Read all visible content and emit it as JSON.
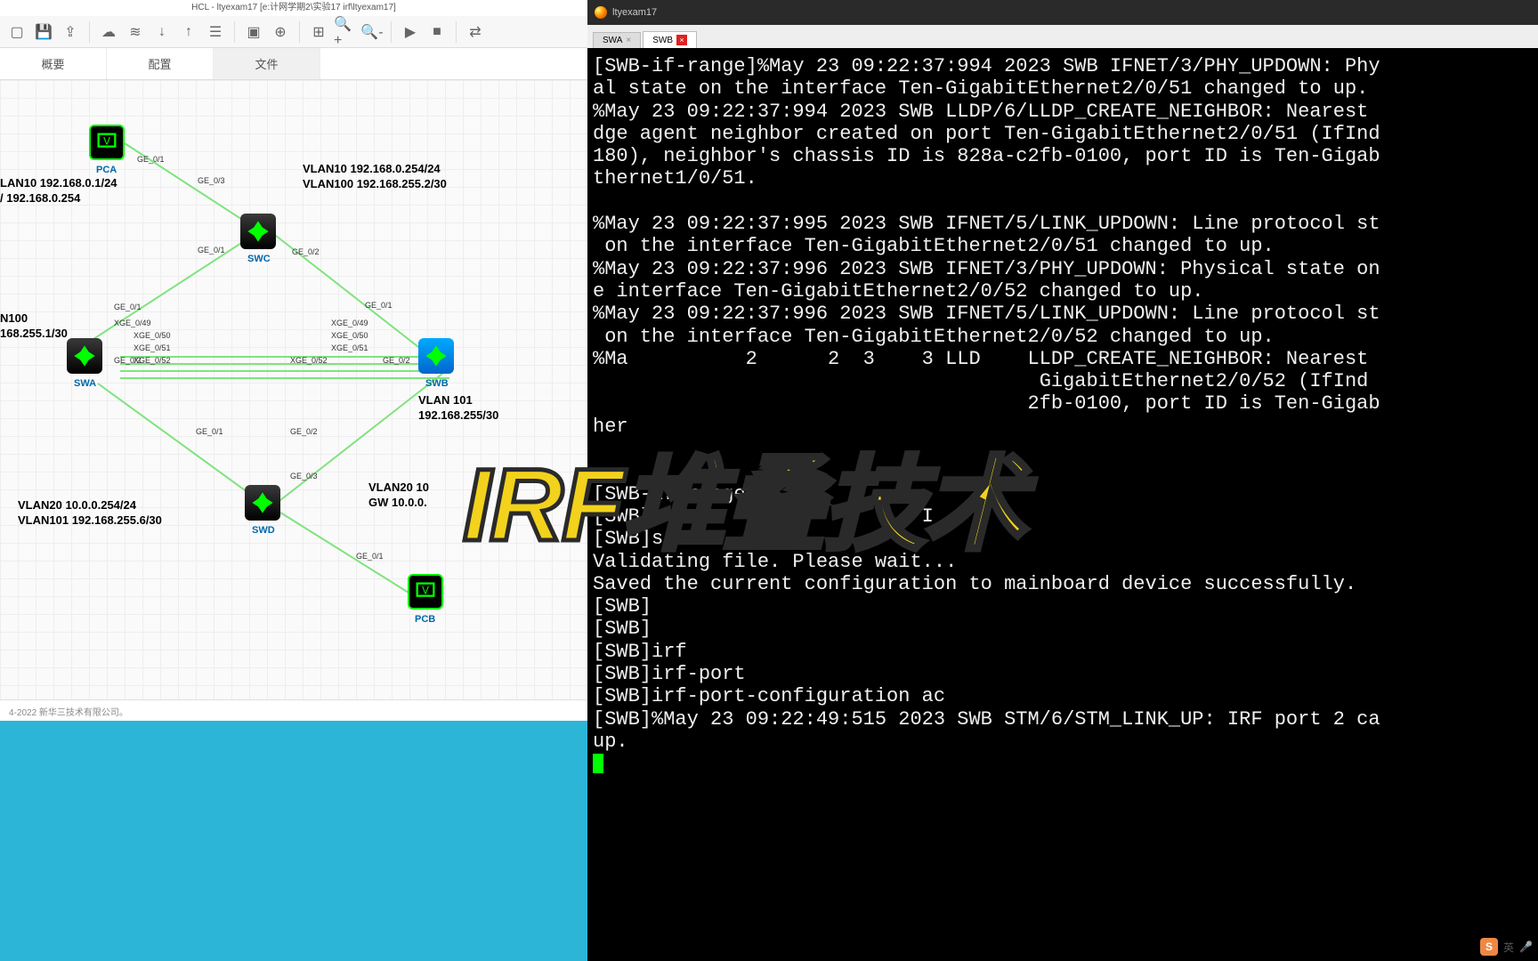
{
  "app": {
    "title": "HCL - ltyexam17 [e:计网学期2\\实验17 irf\\ltyexam17]"
  },
  "tabs": {
    "summary": "概要",
    "config": "配置",
    "file": "文件"
  },
  "footer": "4-2022 新华三技术有限公司。",
  "overlay": "IRF堆叠技术",
  "nodes": {
    "pca": {
      "label": "PCA"
    },
    "pcb": {
      "label": "PCB"
    },
    "swa": {
      "label": "SWA"
    },
    "swb": {
      "label": "SWB"
    },
    "swc": {
      "label": "SWC"
    },
    "swd": {
      "label": "SWD"
    }
  },
  "vlan_labels": {
    "l1": "LAN10 192.168.0.1/24\n/ 192.168.0.254",
    "l2": "VLAN10 192.168.0.254/24\nVLAN100 192.168.255.2/30",
    "l3": "N100\n168.255.1/30",
    "l4": "VLAN 101\n192.168.255/30",
    "l5": "VLAN20 10.0.0.254/24\nVLAN101 192.168.255.6/30",
    "l6": "VLAN20 10\nGW 10.0.0."
  },
  "ports": {
    "p1": "GE_0/1",
    "p2": "GE_0/3",
    "p3": "GE_0/1",
    "p4": "GE_0/2",
    "p5": "GE_0/1",
    "p6": "XGE_0/49",
    "p7": "XGE_0/50",
    "p8": "XGE_0/51",
    "p9": "GE_0/2",
    "p10": "XGE_0/52",
    "p11": "GE_0/1",
    "p12": "XGE_0/49",
    "p13": "XGE_0/50",
    "p14": "XGE_0/51",
    "p15": "GE_0/2",
    "p16": "XGE_0/52",
    "p17": "GE_0/1",
    "p18": "GE_0/2",
    "p19": "GE_0/3",
    "p20": "GE_0/1"
  },
  "terminal": {
    "title": "ltyexam17",
    "tabs": {
      "swa": "SWA",
      "swb": "SWB"
    },
    "lines": [
      "[SWB-if-range]%May 23 09:22:37:994 2023 SWB IFNET/3/PHY_UPDOWN: Phy",
      "al state on the interface Ten-GigabitEthernet2/0/51 changed to up.",
      "%May 23 09:22:37:994 2023 SWB LLDP/6/LLDP_CREATE_NEIGHBOR: Nearest ",
      "dge agent neighbor created on port Ten-GigabitEthernet2/0/51 (IfInd",
      "180), neighbor's chassis ID is 828a-c2fb-0100, port ID is Ten-Gigab",
      "thernet1/0/51.",
      "",
      "%May 23 09:22:37:995 2023 SWB IFNET/5/LINK_UPDOWN: Line protocol st",
      " on the interface Ten-GigabitEthernet2/0/51 changed to up.",
      "%May 23 09:22:37:996 2023 SWB IFNET/3/PHY_UPDOWN: Physical state on",
      "e interface Ten-GigabitEthernet2/0/52 changed to up.",
      "%May 23 09:22:37:996 2023 SWB IFNET/5/LINK_UPDOWN: Line protocol st",
      " on the interface Ten-GigabitEthernet2/0/52 changed to up.",
      "%Ma          2      2  3    3 LLD    LLDP_CREATE_NEIGHBOR: Nearest ",
      "                                      GigabitEthernet2/0/52 (IfInd",
      "                                     2fb-0100, port ID is Ten-Gigab",
      "her",
      "",
      "",
      "[SWB-if-range]qu",
      "[SWB]                       I",
      "[SWB]sa f",
      "Validating file. Please wait...",
      "Saved the current configuration to mainboard device successfully.",
      "[SWB]",
      "[SWB]",
      "[SWB]irf",
      "[SWB]irf-port",
      "[SWB]irf-port-configuration ac",
      "[SWB]%May 23 09:22:49:515 2023 SWB STM/6/STM_LINK_UP: IRF port 2 ca",
      "up."
    ]
  },
  "ime": {
    "letter": "英"
  }
}
